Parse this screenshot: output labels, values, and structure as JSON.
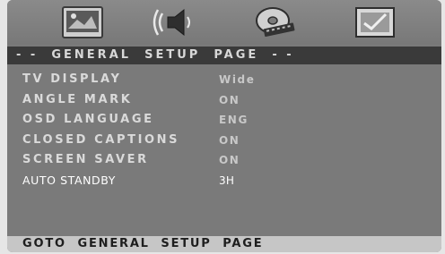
{
  "icons": [
    {
      "name": "general-setup-icon"
    },
    {
      "name": "audio-setup-icon"
    },
    {
      "name": "video-setup-icon"
    },
    {
      "name": "preference-setup-icon"
    }
  ],
  "title": "- -  GENERAL  SETUP  PAGE  - -",
  "menu": [
    {
      "label": "TV  DISPLAY",
      "value": "Wide"
    },
    {
      "label": "ANGLE  MARK",
      "value": "ON"
    },
    {
      "label": "OSD  LANGUAGE",
      "value": "ENG"
    },
    {
      "label": "CLOSED  CAPTIONS",
      "value": "ON"
    },
    {
      "label": "SCREEN  SAVER",
      "value": "ON"
    },
    {
      "label": "AUTO  STANDBY",
      "value": "3H"
    }
  ],
  "status": "GOTO  GENERAL  SETUP  PAGE",
  "colors": {
    "screen_bg": "#7a7a7a",
    "title_bar_bg": "#3a3a3a",
    "status_bar_bg": "#c6c6c6",
    "selected_text": "#ffffff"
  }
}
